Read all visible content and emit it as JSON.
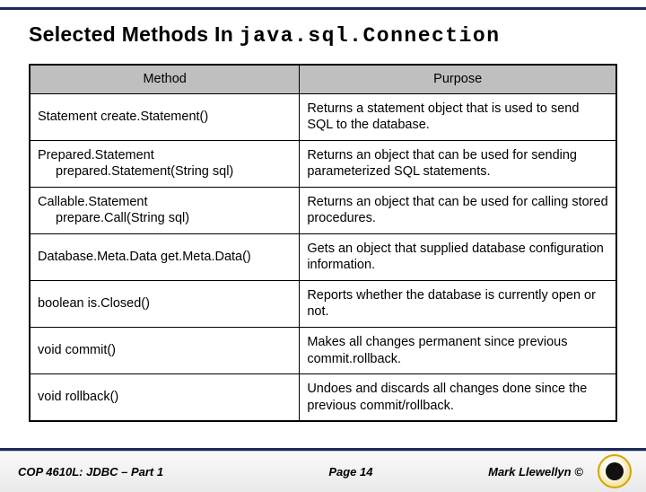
{
  "title_plain": "Selected Methods In ",
  "title_code": "java.sql.Connection",
  "table": {
    "head": {
      "method": "Method",
      "purpose": "Purpose"
    },
    "rows": [
      {
        "method_line1": "Statement  create.Statement()",
        "method_line2": "",
        "purpose": "Returns a statement object that is used to send SQL to the database."
      },
      {
        "method_line1": "Prepared.Statement",
        "method_line2": "prepared.Statement(String sql)",
        "purpose": "Returns an object that can be used for sending parameterized SQL statements."
      },
      {
        "method_line1": "Callable.Statement",
        "method_line2": "prepare.Call(String sql)",
        "purpose": "Returns an object that can be used for calling stored procedures."
      },
      {
        "method_line1": "Database.Meta.Data  get.Meta.Data()",
        "method_line2": "",
        "purpose": "Gets an object that supplied database configuration information."
      },
      {
        "method_line1": "boolean  is.Closed()",
        "method_line2": "",
        "purpose": "Reports whether the database is currently open or not."
      },
      {
        "method_line1": "void commit()",
        "method_line2": "",
        "purpose": "Makes all changes permanent since previous commit.rollback."
      },
      {
        "method_line1": "void rollback()",
        "method_line2": "",
        "purpose": "Undoes and discards all changes done since the previous commit/rollback."
      }
    ]
  },
  "footer": {
    "left": "COP 4610L: JDBC – Part 1",
    "center": "Page 14",
    "right": "Mark Llewellyn ©"
  }
}
